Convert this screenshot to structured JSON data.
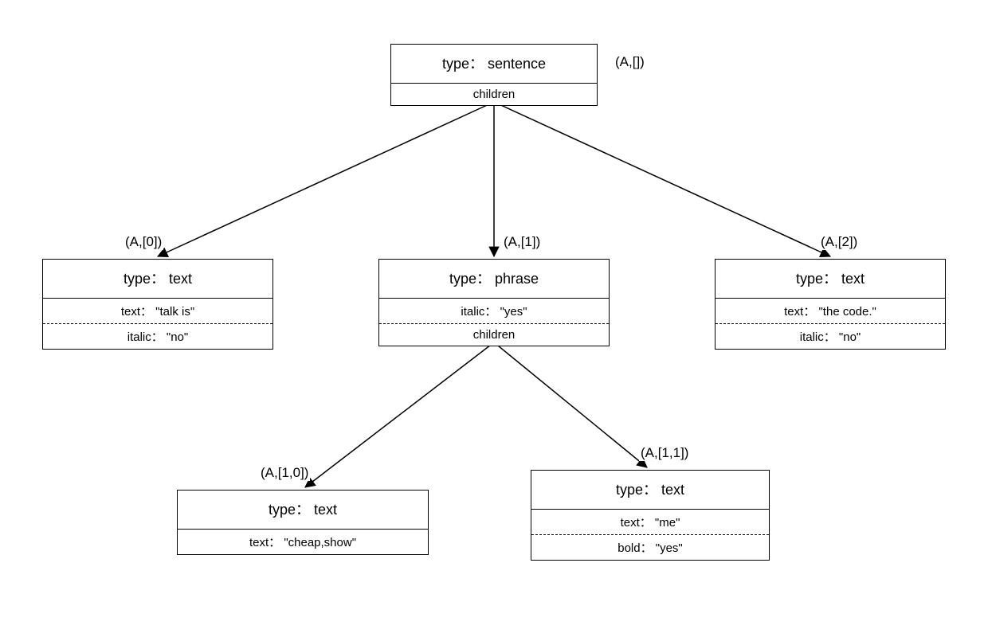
{
  "root": {
    "header": "type： sentence",
    "row1": "children",
    "label": "(A,[])"
  },
  "n0": {
    "header": "type： text",
    "row1": "text： \"talk is\"",
    "row2": "italic： \"no\"",
    "label": "(A,[0])"
  },
  "n1": {
    "header": "type： phrase",
    "row1": "italic： \"yes\"",
    "row2": "children",
    "label": "(A,[1])"
  },
  "n2": {
    "header": "type： text",
    "row1": "text： \"the code.\"",
    "row2": "italic： \"no\"",
    "label": "(A,[2])"
  },
  "n10": {
    "header": "type： text",
    "row1": "text： \"cheap,show\"",
    "label": "(A,[1,0])"
  },
  "n11": {
    "header": "type： text",
    "row1": "text： \"me\"",
    "row2": "bold： \"yes\"",
    "label": "(A,[1,1])"
  }
}
